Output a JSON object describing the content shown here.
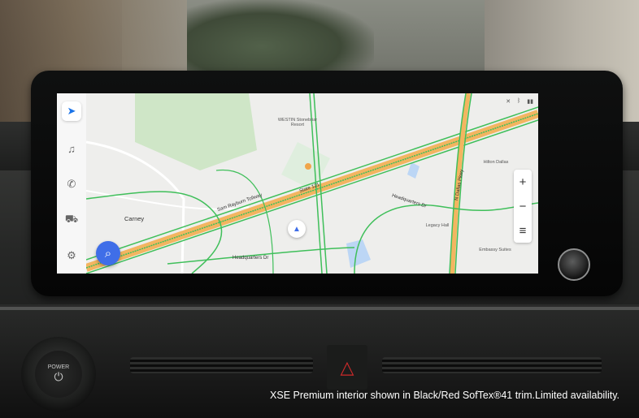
{
  "sidebar": {
    "items": [
      {
        "icon": "navigation-arrow-icon",
        "glyph": "➤"
      },
      {
        "icon": "music-note-icon",
        "glyph": "♫"
      },
      {
        "icon": "phone-icon",
        "glyph": "✆"
      },
      {
        "icon": "car-icon",
        "glyph": "⛟"
      },
      {
        "icon": "gear-icon",
        "glyph": "⚙"
      }
    ]
  },
  "map": {
    "labels": {
      "carney": "Carney",
      "sam_rayburn": "Sam Rayburn Tollway",
      "state_121": "State 121",
      "headquarters_dr_1": "Headquarters Dr",
      "headquarters_dr_2": "Headquarters Dr",
      "dallas_pkwy": "N Dallas Pkwy",
      "westin": "WESTIN Stonebriar Resort",
      "hilton": "Hilton Dallas",
      "legacy": "Legacy Hall",
      "embassy": "Embassy Suites"
    },
    "zoom_in": "+",
    "zoom_out": "−",
    "menu": "≡",
    "search_glyph": "⌕",
    "compass_glyph": "▲"
  },
  "hardware": {
    "power_label": "POWER",
    "power_glyph": "⏻",
    "hazard_glyph": "△"
  },
  "caption": "XSE Premium interior shown in Black/Red SofTex®41 trim.Limited availability.",
  "colors": {
    "accent": "#3f6ee8",
    "traffic_green": "#3fbf5a",
    "highway_orange": "#f0a54a"
  }
}
